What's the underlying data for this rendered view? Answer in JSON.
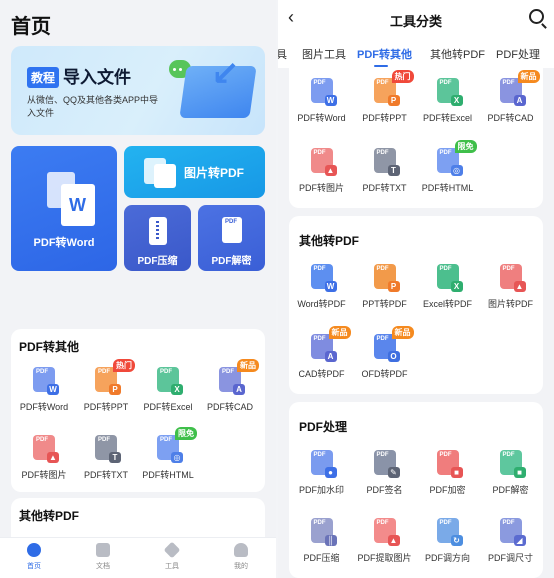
{
  "left": {
    "title": "首页",
    "banner": {
      "tag": "教程",
      "title": "导入文件",
      "subtitle": "从微信、QQ及其他各类APP中导入文件"
    },
    "tiles": {
      "pdf_to_word": "PDF转Word",
      "image_to_pdf": "图片转PDF",
      "pdf_compress": "PDF压缩",
      "pdf_decrypt": "PDF解密"
    },
    "section1": {
      "title": "PDF转其他",
      "items": [
        "PDF转Word",
        "PDF转PPT",
        "PDF转Excel",
        "PDF转CAD",
        "PDF转图片",
        "PDF转TXT",
        "PDF转HTML"
      ],
      "badges": {
        "hot": "热门",
        "new": "新品",
        "free": "限免"
      }
    },
    "section2": {
      "title": "其他转PDF"
    },
    "tabbar": [
      "首页",
      "文档",
      "工具",
      "我的"
    ]
  },
  "right": {
    "title": "工具分类",
    "categories": [
      "具",
      "图片工具",
      "PDF转其他",
      "其他转PDF",
      "PDF处理"
    ],
    "group1": {
      "items": [
        "PDF转Word",
        "PDF转PPT",
        "PDF转Excel",
        "PDF转CAD",
        "PDF转图片",
        "PDF转TXT",
        "PDF转HTML"
      ]
    },
    "group2": {
      "title": "其他转PDF",
      "items": [
        "Word转PDF",
        "PPT转PDF",
        "Excel转PDF",
        "图片转PDF",
        "CAD转PDF",
        "OFD转PDF"
      ]
    },
    "group3": {
      "title": "PDF处理",
      "items": [
        "PDF加水印",
        "PDF签名",
        "PDF加密",
        "PDF解密",
        "PDF压缩",
        "PDF提取图片",
        "PDF调方向",
        "PDF调尺寸"
      ]
    },
    "badges": {
      "hot": "热门",
      "new": "新品",
      "free": "限免"
    }
  },
  "colors": {
    "accent": "#2f6ce6",
    "hot": "#f0493a",
    "new": "#f58a1f",
    "free": "#3fbf4a"
  },
  "icon_text": {
    "pdf": "PDF",
    "word": "W",
    "excel": "X",
    "ppt": "P",
    "txt": "T",
    "cad": "A",
    "ofd": "O"
  }
}
